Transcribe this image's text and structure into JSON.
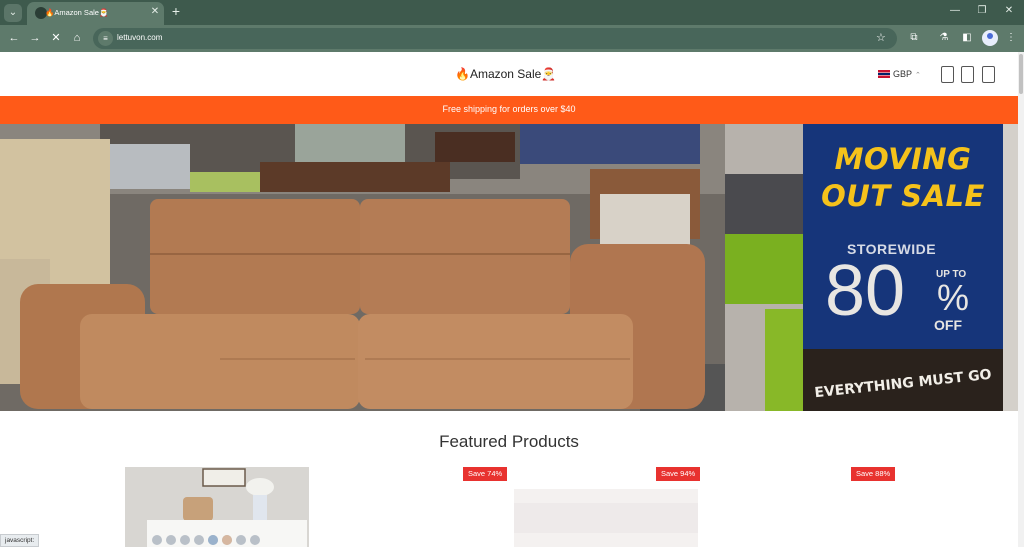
{
  "browser": {
    "tab_title": "🔥Amazon Sale🎅",
    "url": "lettuvon.com",
    "status_text": "javascript:"
  },
  "header": {
    "logo_text": "🔥Amazon Sale🎅",
    "currency": "GBP"
  },
  "announcement": {
    "text": "Free shipping for orders over $40"
  },
  "hero": {
    "sign_line1": "MOVING",
    "sign_line2": "OUT SALE",
    "sign_storewide": "STOREWIDE",
    "sign_percent": "80",
    "sign_percent_symbol": "%",
    "sign_up_to": "UP TO",
    "sign_off": "OFF",
    "sign_bottom": "EVERYTHING MUST GO"
  },
  "featured": {
    "title": "Featured Products",
    "badges": [
      "Save 74%",
      "Save 94%",
      "Save 88%"
    ]
  },
  "colors": {
    "chrome": "#3e5a4d",
    "chrome_active": "#5e7a6b",
    "announcement_bg": "#ff5a18",
    "badge_bg": "#e8322f",
    "sign_bg": "#16357a",
    "sign_yellow": "#f5c21b"
  }
}
